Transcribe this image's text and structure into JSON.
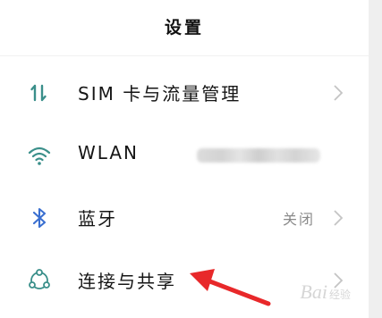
{
  "header": {
    "title": "设置"
  },
  "settings": {
    "sim": {
      "label": "SIM 卡与流量管理",
      "icon": "sim-data-arrows-icon"
    },
    "wlan": {
      "label": "WLAN",
      "icon": "wifi-icon"
    },
    "bluetooth": {
      "label": "蓝牙",
      "value": "关闭",
      "icon": "bluetooth-icon"
    },
    "connection": {
      "label": "连接与共享",
      "icon": "connection-sharing-icon"
    }
  },
  "watermark": {
    "text": "Bai",
    "suffix": "经验"
  },
  "colors": {
    "accent": "#3a8f8a",
    "annotation_arrow": "#e8282a",
    "chevron": "#c4c4c4",
    "secondary_text": "#8a8a8a"
  }
}
